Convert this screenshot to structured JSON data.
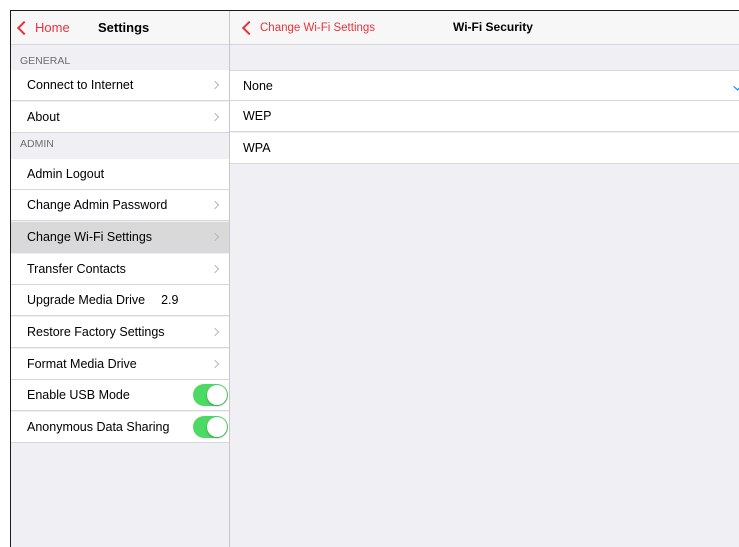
{
  "master": {
    "back_label": "Home",
    "title": "Settings",
    "sections": [
      {
        "header": "GENERAL",
        "rows": [
          {
            "label": "Connect to Internet",
            "chevron": true
          },
          {
            "label": "About",
            "chevron": true
          }
        ]
      },
      {
        "header": "ADMIN",
        "rows": [
          {
            "label": "Admin Logout",
            "chevron": false
          },
          {
            "label": "Change Admin Password",
            "chevron": true
          },
          {
            "label": "Change Wi-Fi Settings",
            "chevron": true,
            "selected": true
          },
          {
            "label": "Transfer Contacts",
            "chevron": true
          },
          {
            "label": "Upgrade Media Drive",
            "value": "2.9",
            "chevron": false
          },
          {
            "label": "Restore Factory Settings",
            "chevron": true
          },
          {
            "label": "Format Media Drive",
            "chevron": true
          },
          {
            "label": "Enable USB Mode",
            "toggle": true
          },
          {
            "label": "Anonymous Data Sharing",
            "toggle": true
          }
        ]
      }
    ]
  },
  "detail": {
    "back_label": "Change Wi-Fi Settings",
    "title": "Wi-Fi Security",
    "options": [
      {
        "label": "None",
        "checked": true
      },
      {
        "label": "WEP",
        "checked": false
      },
      {
        "label": "WPA",
        "checked": false
      }
    ]
  },
  "colors": {
    "accent": "#e8323c",
    "checkmark": "#007aff",
    "toggle_on": "#4cd964",
    "selected_row": "#d9d9d9",
    "grouped_background": "#efeff4"
  },
  "icons": [
    "chevron-left-icon",
    "chevron-right-icon",
    "checkmark-icon"
  ]
}
